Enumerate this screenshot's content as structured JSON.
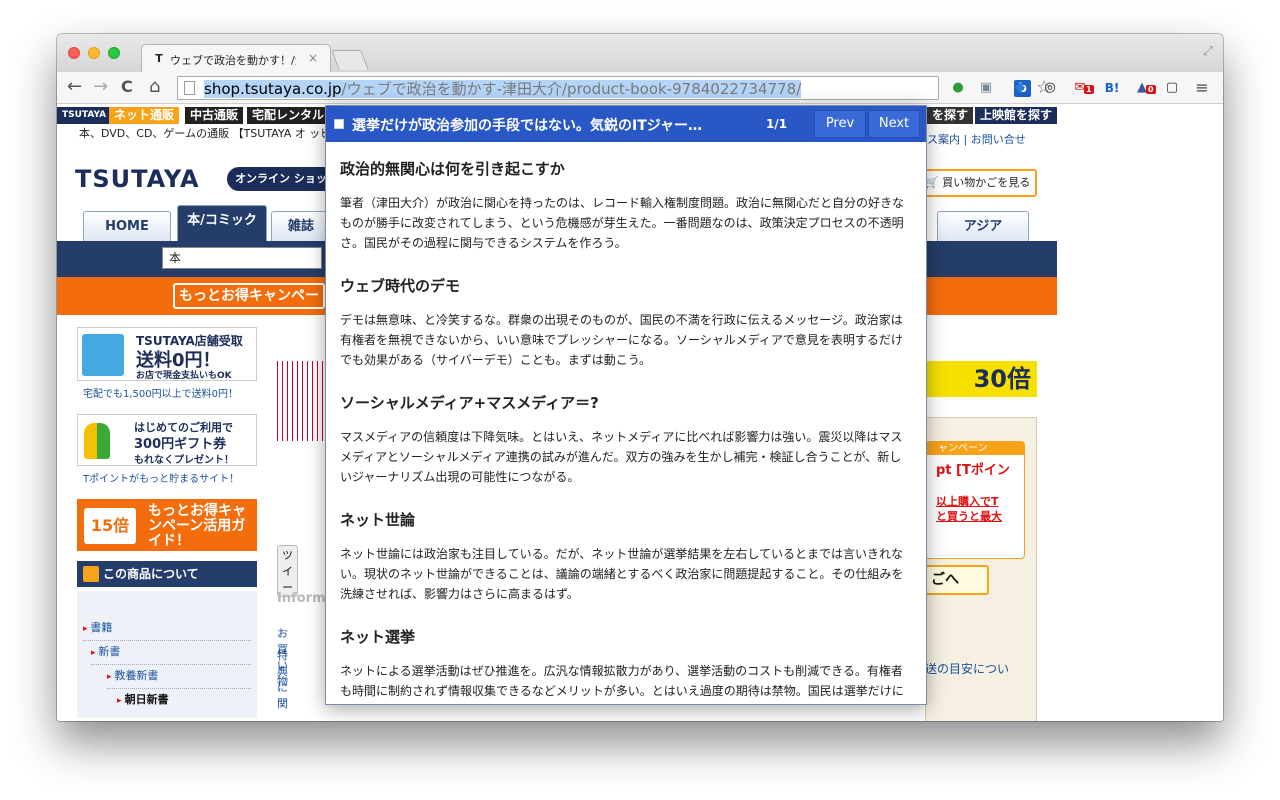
{
  "browser": {
    "tab_title": "ウェブで政治を動かす！/津田",
    "tab_close": "×",
    "url_host": "shop.tsutaya.co.jp",
    "url_path": "/ウェブで政治を動かす-津田大介/product-book-9784022734778/",
    "nav": {
      "back": "←",
      "forward": "→",
      "reload": "C",
      "home": "⌂"
    },
    "ext_b": "b",
    "star": "☆",
    "hatena_label": "B!",
    "mail_badge": "1",
    "like_badge": "0",
    "menu": "≡"
  },
  "site": {
    "services": [
      "TSUTAYA",
      "ネット通販",
      "中古通販",
      "宅配レンタル"
    ],
    "services_right": [
      "を探す",
      "上映館を探す"
    ],
    "description": "本、DVD、CD、ゲームの通販 【TSUTAYA オ ッピング】",
    "top_links": "ス案内 | お問い合せ",
    "logo": "TSUTAYA",
    "online_badge": "オンライン ショッピ",
    "cart_button": "買い物かごを見る",
    "tabs": [
      "HOME",
      "本/コミック",
      "雑誌",
      "アジア"
    ],
    "search_category": "本",
    "campaign_button": "もっとお得キャンペー",
    "tpoint_banner": "30倍"
  },
  "left": {
    "promo1": {
      "t1": "TSUTAYA店舗受取",
      "t2": "送料0円！",
      "t3": "お店で現金支払いもOK",
      "note": "宅配でも1,500円以上で送料0円！"
    },
    "promo2": {
      "t1": "はじめてのご利用で",
      "t2": "300円ギフト券",
      "t3": "もれなくプレゼント！",
      "note": "Tポイントがもっと貯まるサイト！"
    },
    "promo3": {
      "icon": "15倍",
      "t1": "もっとお得キャンペーン活用ガイド！"
    },
    "about_head": "この商品について",
    "categories": [
      "書籍",
      "新書",
      "教養新書",
      "朝日新書"
    ]
  },
  "mid": {
    "tweet": "ツイー",
    "info_head": "Informa",
    "links": [
      "お買い物",
      "特典に関"
    ]
  },
  "right": {
    "campaign_head": "ャンペーン",
    "campaign_red": "pt [Tポイン",
    "campaign_link1": "以上購入でT",
    "campaign_link2": "と買うと最大",
    "cart_big": "ごへ",
    "side_link": "送の目安につい"
  },
  "popup": {
    "title": "選挙だけが政治参加の手段ではない。気鋭のITジャー…",
    "count": "1/1",
    "prev": "Prev",
    "next": "Next",
    "sections": [
      {
        "heading": "政治的無関心は何を引き起こすか",
        "body": "筆者（津田大介）が政治に関心を持ったのは、レコード輸入権制度問題。政治に無関心だと自分の好きなものが勝手に改変されてしまう、という危機感が芽生えた。一番問題なのは、政策決定プロセスの不透明さ。国民がその過程に関与できるシステムを作ろう。"
      },
      {
        "heading": "ウェブ時代のデモ",
        "body": "デモは無意味、と冷笑するな。群衆の出現そのものが、国民の不満を行政に伝えるメッセージ。政治家は有権者を無視できないから、いい意味でプレッシャーになる。ソーシャルメディアで意見を表明するだけでも効果がある（サイバーデモ）ことも。まずは動こう。"
      },
      {
        "heading": "ソーシャルメディア+マスメディア＝?",
        "body": "マスメディアの信頼度は下降気味。とはいえ、ネットメディアに比べれば影響力は強い。震災以降はマスメディアとソーシャルメディア連携の試みが進んだ。双方の強みを生かし補完・検証し合うことが、新しいジャーナリズム出現の可能性につながる。"
      },
      {
        "heading": "ネット世論",
        "body": "ネット世論には政治家も注目している。だが、ネット世論が選挙結果を左右しているとまでは言いきれない。現状のネット世論ができることは、議論の端緒とするべく政治家に問題提起すること。その仕組みを洗練させれば、影響力はさらに高まるはず。"
      },
      {
        "heading": "ネット選挙",
        "body": "ネットによる選挙活動はぜひ推進を。広汎な情報拡散力があり、選挙活動のコストも削減できる。有権者も時間に制約されず情報収集できるなどメリットが多い。とはいえ過度の期待は禁物。国民は選挙だけに依存せず、常に民意を政治家に届ける努力が必要だ。"
      }
    ]
  }
}
